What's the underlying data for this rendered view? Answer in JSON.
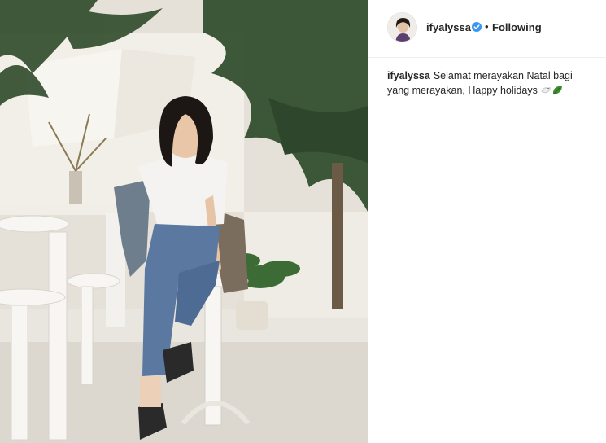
{
  "post": {
    "author": "ifyalyssa",
    "verified": true,
    "follow_separator": "•",
    "follow_status": "Following",
    "caption_user": "ifyalyssa",
    "caption_text": "Selamat merayakan Natal bagi yang merayakan, Happy holidays",
    "caption_emojis": [
      "dove-emoji",
      "leaf-emoji"
    ]
  },
  "colors": {
    "verified_badge": "#3897f0",
    "text": "#262626",
    "divider": "#efefef",
    "leaf": "#3e8e2f"
  }
}
